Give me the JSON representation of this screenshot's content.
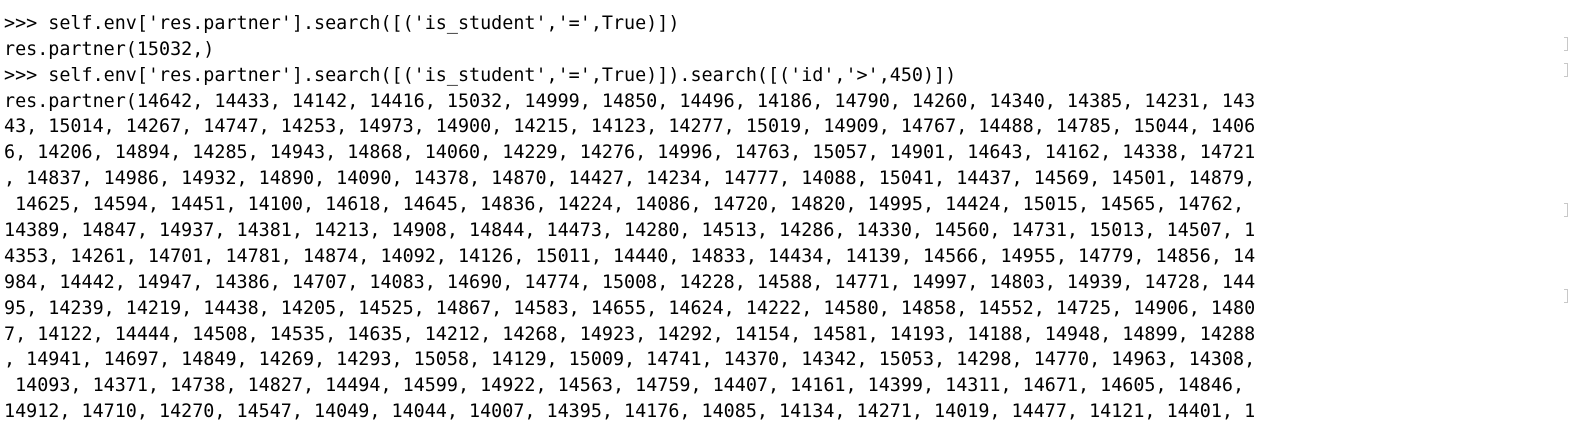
{
  "terminal": {
    "lines": [
      "                                                                                                                      ",
      ">>> self.env['res.partner'].search([('is_student','=',True)])",
      "res.partner(15032,)",
      ">>> self.env['res.partner'].search([('is_student','=',True)]).search([('id','>',450)])",
      "res.partner(14642, 14433, 14142, 14416, 15032, 14999, 14850, 14496, 14186, 14790, 14260, 14340, 14385, 14231, 143",
      "43, 15014, 14267, 14747, 14253, 14973, 14900, 14215, 14123, 14277, 15019, 14909, 14767, 14488, 14785, 15044, 1406",
      "6, 14206, 14894, 14285, 14943, 14868, 14060, 14229, 14276, 14996, 14763, 15057, 14901, 14643, 14162, 14338, 14721",
      ", 14837, 14986, 14932, 14890, 14090, 14378, 14870, 14427, 14234, 14777, 14088, 15041, 14437, 14569, 14501, 14879,",
      " 14625, 14594, 14451, 14100, 14618, 14645, 14836, 14224, 14086, 14720, 14820, 14995, 14424, 15015, 14565, 14762,",
      "14389, 14847, 14937, 14381, 14213, 14908, 14844, 14473, 14280, 14513, 14286, 14330, 14560, 14731, 15013, 14507, 1",
      "4353, 14261, 14701, 14781, 14874, 14092, 14126, 15011, 14440, 14833, 14434, 14139, 14566, 14955, 14779, 14856, 14",
      "984, 14442, 14947, 14386, 14707, 14083, 14690, 14774, 15008, 14228, 14588, 14771, 14997, 14803, 14939, 14728, 144",
      "95, 14239, 14219, 14438, 14205, 14525, 14867, 14583, 14655, 14624, 14222, 14580, 14858, 14552, 14725, 14906, 1480",
      "7, 14122, 14444, 14508, 14535, 14635, 14212, 14268, 14923, 14292, 14154, 14581, 14193, 14188, 14948, 14899, 14288",
      ", 14941, 14697, 14849, 14269, 14293, 15058, 14129, 15009, 14741, 14370, 14342, 15053, 14298, 14770, 14963, 14308,",
      " 14093, 14371, 14738, 14827, 14494, 14599, 14922, 14563, 14759, 14407, 14161, 14399, 14311, 14671, 14605, 14846,",
      "14912, 14710, 14270, 14547, 14049, 14044, 14007, 14395, 14176, 14085, 14134, 14271, 14019, 14477, 14121, 14401, 1"
    ]
  },
  "colors": {
    "background": "#ffffff",
    "text": "#000000",
    "marker": "#c8c8c8"
  }
}
